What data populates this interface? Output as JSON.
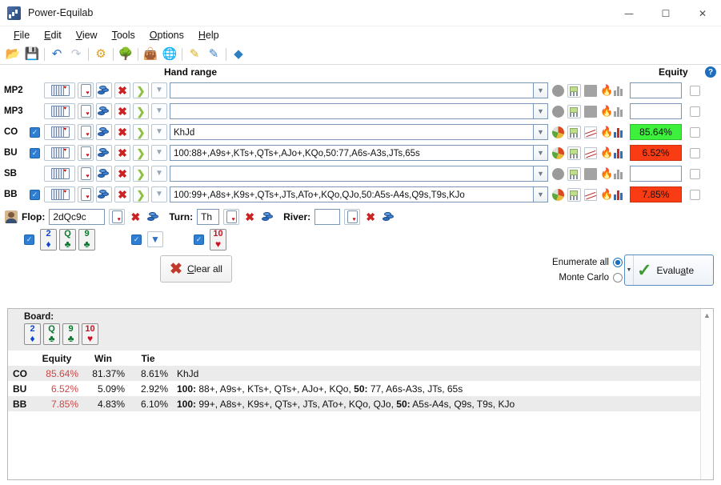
{
  "window": {
    "title": "Power-Equilab",
    "icon": "app-chart-icon",
    "minimize": "—",
    "maximize": "☐",
    "close": "✕"
  },
  "menu": {
    "items": [
      {
        "label": "File",
        "accel": "F"
      },
      {
        "label": "Edit",
        "accel": "E"
      },
      {
        "label": "View",
        "accel": "V"
      },
      {
        "label": "Tools",
        "accel": "T"
      },
      {
        "label": "Options",
        "accel": "O"
      },
      {
        "label": "Help",
        "accel": "H"
      }
    ]
  },
  "toolbar": {
    "buttons": [
      {
        "name": "open-icon",
        "glyph": "📂"
      },
      {
        "name": "save-icon",
        "glyph": "💾"
      },
      {
        "name": "undo-icon",
        "glyph": "↶"
      },
      {
        "name": "redo-icon",
        "glyph": "↷"
      },
      {
        "name": "settings-icon",
        "glyph": "⚙"
      },
      {
        "name": "tree-icon",
        "glyph": "🌳"
      },
      {
        "name": "bag-icon",
        "glyph": "👜"
      },
      {
        "name": "globe-icon",
        "glyph": "🌐"
      },
      {
        "name": "pencil-yellow-icon",
        "glyph": "✎"
      },
      {
        "name": "pencil-blue-icon",
        "glyph": "✏"
      },
      {
        "name": "eraser-icon",
        "glyph": "◆"
      }
    ]
  },
  "columns": {
    "hand_range": "Hand range",
    "equity": "Equity",
    "help": "?"
  },
  "players": [
    {
      "position": "MP2",
      "enabled": false,
      "range": "",
      "equity": "",
      "equity_state": "empty",
      "icons_active": false,
      "selected": false
    },
    {
      "position": "MP3",
      "enabled": false,
      "range": "",
      "equity": "",
      "equity_state": "empty",
      "icons_active": false,
      "selected": false
    },
    {
      "position": "CO",
      "enabled": true,
      "range": "KhJd",
      "equity": "85.64%",
      "equity_state": "green",
      "icons_active": true,
      "selected": false
    },
    {
      "position": "BU",
      "enabled": true,
      "range": "100:88+,A9s+,KTs+,QTs+,AJo+,KQo,50:77,A6s-A3s,JTs,65s",
      "equity": "6.52%",
      "equity_state": "red",
      "icons_active": true,
      "selected": false
    },
    {
      "position": "SB",
      "enabled": false,
      "range": "",
      "equity": "",
      "equity_state": "empty",
      "icons_active": false,
      "selected": false
    },
    {
      "position": "BB",
      "enabled": true,
      "range": "100:99+,A8s+,K9s+,QTs+,JTs,ATo+,KQo,QJo,50:A5s-A4s,Q9s,T9s,KJo",
      "equity": "7.85%",
      "equity_state": "red",
      "icons_active": true,
      "selected": false
    }
  ],
  "board_inputs": {
    "flop_label": "Flop:",
    "flop_value": "2dQc9c",
    "turn_label": "Turn:",
    "turn_value": "Th",
    "river_label": "River:",
    "river_value": ""
  },
  "board_cards_row": {
    "flop": [
      {
        "rank": "2",
        "suit": "♦",
        "color": "d"
      },
      {
        "rank": "Q",
        "suit": "♣",
        "color": "c"
      },
      {
        "rank": "9",
        "suit": "♣",
        "color": "c"
      }
    ],
    "turn": [
      {
        "rank": "10",
        "suit": "♥",
        "color": "h"
      }
    ],
    "flop_checked": true,
    "turn_checked": true,
    "river_checked": true
  },
  "actions": {
    "clear_all": "Clear all",
    "clear_all_accel": "C",
    "enumerate_all": "Enumerate all",
    "monte_carlo": "Monte Carlo",
    "mode_selected": "Enumerate all",
    "evaluate": "Evaluate",
    "evaluate_accel": "a"
  },
  "results": {
    "board_label": "Board:",
    "board_cards": [
      {
        "rank": "2",
        "suit": "♦",
        "color": "d"
      },
      {
        "rank": "Q",
        "suit": "♣",
        "color": "c"
      },
      {
        "rank": "9",
        "suit": "♣",
        "color": "c"
      },
      {
        "rank": "10",
        "suit": "♥",
        "color": "h"
      }
    ],
    "headers": [
      "",
      "Equity",
      "Win",
      "Tie",
      ""
    ],
    "rows": [
      {
        "position": "CO",
        "equity": "85.64%",
        "win": "81.37%",
        "tie": "8.61%",
        "range_prefix_1": "",
        "range_body_1": "KhJd",
        "range_prefix_2": "",
        "range_body_2": ""
      },
      {
        "position": "BU",
        "equity": "6.52%",
        "win": "5.09%",
        "tie": "2.92%",
        "range_prefix_1": "100:",
        "range_body_1": " 88+, A9s+, KTs+, QTs+, AJo+, KQo, ",
        "range_prefix_2": "50:",
        "range_body_2": " 77, A6s-A3s, JTs, 65s"
      },
      {
        "position": "BB",
        "equity": "7.85%",
        "win": "4.83%",
        "tie": "6.10%",
        "range_prefix_1": "100:",
        "range_body_1": " 99+, A8s+, K9s+, QTs+, JTs, ATo+, KQo, QJo, ",
        "range_prefix_2": "50:",
        "range_body_2": " A5s-A4s, Q9s, T9s, KJo"
      }
    ]
  },
  "colors": {
    "equity_green": "#3cf03c",
    "equity_red": "#fa3c14",
    "result_equity_text": "#d04545",
    "accent_blue": "#2e7fd4"
  }
}
